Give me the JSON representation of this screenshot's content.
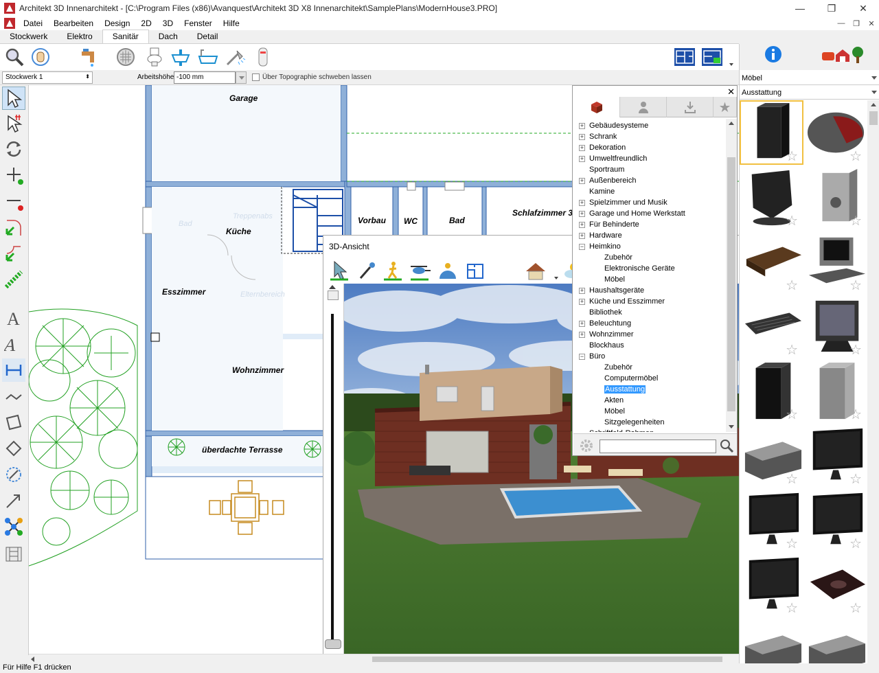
{
  "window": {
    "title": "Architekt 3D Innenarchitekt - [C:\\Program Files (x86)\\Avanquest\\Architekt 3D X8 Innenarchitekt\\SamplePlans\\ModernHouse3.PRO]",
    "minimize": "—",
    "restore": "❐",
    "close": "✕"
  },
  "menu": {
    "items": [
      "Datei",
      "Bearbeiten",
      "Design",
      "2D",
      "3D",
      "Fenster",
      "Hilfe"
    ],
    "mdi_minimize": "—",
    "mdi_restore": "❐",
    "mdi_close": "✕"
  },
  "tabs": [
    "Stockwerk",
    "Elektro",
    "Sanitär",
    "Dach",
    "Detail"
  ],
  "active_tab": "Sanitär",
  "options": {
    "floor": "Stockwerk 1",
    "work_height_label": "Arbeitshöhe:",
    "work_height_value": "-100 mm",
    "topo_label": "Über Topographie schweben lassen"
  },
  "rooms": {
    "garage": "Garage",
    "kueche": "Küche",
    "treppenabsatz": "Treppenabs",
    "bad_left": "Bad",
    "esszimmer": "Esszimmer",
    "elternbereich": "Elternbereich",
    "wohnzimmer": "Wohnzimmer",
    "terrasse": "überdachte Terrasse",
    "vorbau": "Vorbau",
    "wc": "WC",
    "bad": "Bad",
    "schlafzimmer": "Schlafzimmer 3"
  },
  "view3d": {
    "title": "3D-Ansicht"
  },
  "catalog": {
    "close": "✕",
    "tree": [
      {
        "label": "Gebäudesysteme",
        "level": 0,
        "expand": "+"
      },
      {
        "label": "Schrank",
        "level": 0,
        "expand": "+"
      },
      {
        "label": "Dekoration",
        "level": 0,
        "expand": "+"
      },
      {
        "label": "Umweltfreundlich",
        "level": 0,
        "expand": "+"
      },
      {
        "label": "Sportraum",
        "level": 0,
        "expand": ""
      },
      {
        "label": "Außenbereich",
        "level": 0,
        "expand": "+"
      },
      {
        "label": "Kamine",
        "level": 0,
        "expand": ""
      },
      {
        "label": "Spielzimmer und Musik",
        "level": 0,
        "expand": "+"
      },
      {
        "label": "Garage und Home Werkstatt",
        "level": 0,
        "expand": "+"
      },
      {
        "label": "Für Behinderte",
        "level": 0,
        "expand": "+"
      },
      {
        "label": "Hardware",
        "level": 0,
        "expand": "+"
      },
      {
        "label": "Heimkino",
        "level": 0,
        "expand": "−"
      },
      {
        "label": "Zubehör",
        "level": 1,
        "expand": ""
      },
      {
        "label": "Elektronische Geräte",
        "level": 1,
        "expand": ""
      },
      {
        "label": "Möbel",
        "level": 1,
        "expand": ""
      },
      {
        "label": "Haushaltsgeräte",
        "level": 0,
        "expand": "+"
      },
      {
        "label": "Küche und Esszimmer",
        "level": 0,
        "expand": "+"
      },
      {
        "label": "Bibliothek",
        "level": 0,
        "expand": ""
      },
      {
        "label": "Beleuchtung",
        "level": 0,
        "expand": "+"
      },
      {
        "label": "Wohnzimmer",
        "level": 0,
        "expand": "+"
      },
      {
        "label": "Blockhaus",
        "level": 0,
        "expand": ""
      },
      {
        "label": "Büro",
        "level": 0,
        "expand": "−"
      },
      {
        "label": "Zubehör",
        "level": 1,
        "expand": ""
      },
      {
        "label": "Computermöbel",
        "level": 1,
        "expand": ""
      },
      {
        "label": "Ausstattung",
        "level": 1,
        "expand": "",
        "selected": true
      },
      {
        "label": "Akten",
        "level": 1,
        "expand": ""
      },
      {
        "label": "Möbel",
        "level": 1,
        "expand": ""
      },
      {
        "label": "Sitzgelegenheiten",
        "level": 1,
        "expand": ""
      },
      {
        "label": "Schriftfeld-Rahmen",
        "level": 0,
        "expand": ""
      }
    ]
  },
  "right_panel": {
    "category": "Möbel",
    "subcategory": "Ausstattung",
    "items": [
      "router-icon",
      "mouse-icon",
      "speaker-icon",
      "pc-tower-icon",
      "desk-shelf-icon",
      "crt-computer-icon",
      "keyboard-icon",
      "crt-monitor-icon",
      "black-tower-icon",
      "grey-tower-icon",
      "printer-icon",
      "lcd-monitor-icon",
      "lcd-monitor-icon",
      "lcd-monitor-icon",
      "lcd-monitor-icon",
      "mousepad-icon",
      "printer-icon",
      "printer-icon"
    ],
    "star": "☆"
  },
  "status": "Für Hilfe F1 drücken"
}
